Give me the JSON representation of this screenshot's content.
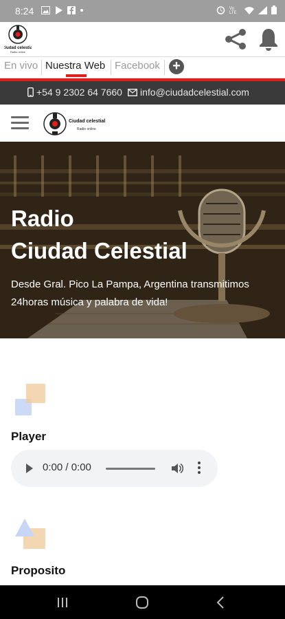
{
  "status_bar": {
    "time": "8:24",
    "notification_icons": [
      "image-icon",
      "play-icon",
      "facebook-icon",
      "dot-icon"
    ],
    "system_icons": [
      "alarm-icon",
      "volte-icon",
      "wifi-icon",
      "signal-icon",
      "battery-icon"
    ]
  },
  "app_bar": {
    "logo_text": "Ciudad celestial",
    "logo_subtext": "Radio online",
    "icons": [
      "share-icon",
      "bell-icon"
    ]
  },
  "tabs": [
    {
      "label": "En vivo",
      "active": false
    },
    {
      "label": "Nuestra Web",
      "active": true
    },
    {
      "label": "Facebook",
      "active": false
    }
  ],
  "contact": {
    "phone": "+54 9 2302 64 7660",
    "email": "info@ciudadcelestial.com"
  },
  "site_header": {
    "logo_text": "Ciudad celestial",
    "logo_subtext": "Radio online"
  },
  "hero": {
    "title_line1": "Radio",
    "title_line2": "Ciudad Celestial",
    "description": "Desde Gral. Pico La Pampa, Argentina transmitimos 24horas música y palabra de vida!"
  },
  "sections": {
    "player_title": "Player",
    "purpose_title": "Proposito"
  },
  "audio_player": {
    "time": "0:00 / 0:00"
  },
  "colors": {
    "accent": "#e21d1d",
    "contact_bar": "#3a3a3a",
    "status_bar": "#9e9e9e"
  },
  "nav_bar": [
    "recents-icon",
    "home-icon",
    "back-icon"
  ]
}
